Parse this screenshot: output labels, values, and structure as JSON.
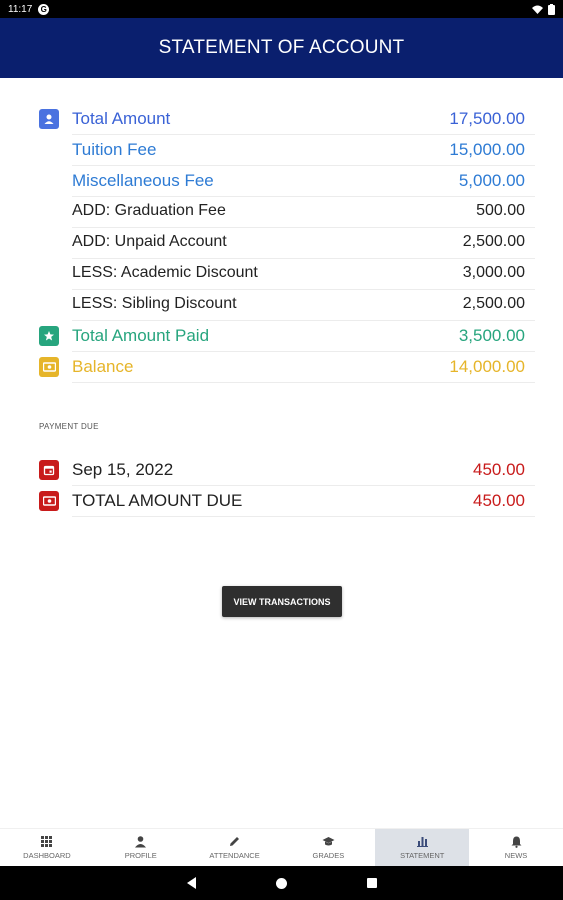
{
  "status_bar": {
    "time": "11:17",
    "app_badge": "G"
  },
  "header": {
    "title": "STATEMENT OF ACCOUNT"
  },
  "summary": {
    "total_amount": {
      "label": "Total Amount",
      "value": "17,500.00"
    },
    "tuition_fee": {
      "label": "Tuition Fee",
      "value": "15,000.00"
    },
    "misc_fee": {
      "label": "Miscellaneous Fee",
      "value": "5,000.00"
    },
    "graduation_fee": {
      "label": "ADD: Graduation Fee",
      "value": "500.00"
    },
    "unpaid_account": {
      "label": "ADD: Unpaid Account",
      "value": "2,500.00"
    },
    "academic_discount": {
      "label": "LESS: Academic Discount",
      "value": "3,000.00"
    },
    "sibling_discount": {
      "label": "LESS: Sibling Discount",
      "value": "2,500.00"
    },
    "total_paid": {
      "label": "Total Amount Paid",
      "value": "3,500.00"
    },
    "balance": {
      "label": "Balance",
      "value": "14,000.00"
    }
  },
  "payment_due": {
    "section_label": "PAYMENT DUE",
    "date_row": {
      "label": "Sep 15, 2022",
      "value": "450.00"
    },
    "total_row": {
      "label": "TOTAL AMOUNT DUE",
      "value": "450.00"
    }
  },
  "actions": {
    "view_transactions": "VIEW TRANSACTIONS"
  },
  "bottom_nav": {
    "dashboard": "DASHBOARD",
    "profile": "PROFILE",
    "attendance": "ATTENDANCE",
    "grades": "GRADES",
    "statement": "STATEMENT",
    "news": "NEWS",
    "active": "statement"
  },
  "colors": {
    "header_bg": "#0a1f6e",
    "total_blue": "#3a62d6",
    "fee_blue": "#2e7bd4",
    "paid_green": "#27a57e",
    "balance_yellow": "#e6b52a",
    "due_red": "#c81b1b"
  },
  "icons": {
    "total_amount": "person-icon",
    "total_paid": "star-icon",
    "balance": "cash-icon",
    "due_date": "calendar-icon",
    "total_due": "cash-icon"
  }
}
